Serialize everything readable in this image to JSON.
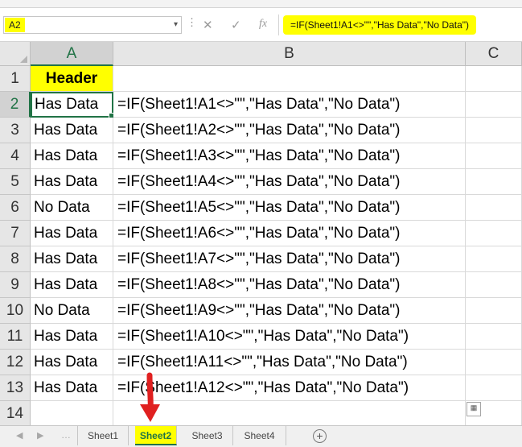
{
  "formula_bar": {
    "name_box": "A2",
    "formula": "=IF(Sheet1!A1<>\"\",\"Has Data\",\"No Data\")",
    "cancel_icon": "x-cancel-icon",
    "enter_icon": "check-enter-icon",
    "fx_label": "fx"
  },
  "grid": {
    "columns": [
      "A",
      "B",
      "C"
    ],
    "rows": [
      {
        "num": "1",
        "a": "Header",
        "b": ""
      },
      {
        "num": "2",
        "a": "Has Data",
        "b": "=IF(Sheet1!A1<>\"\",\"Has Data\",\"No Data\")"
      },
      {
        "num": "3",
        "a": "Has Data",
        "b": "=IF(Sheet1!A2<>\"\",\"Has Data\",\"No Data\")"
      },
      {
        "num": "4",
        "a": "Has Data",
        "b": "=IF(Sheet1!A3<>\"\",\"Has Data\",\"No Data\")"
      },
      {
        "num": "5",
        "a": "Has Data",
        "b": "=IF(Sheet1!A4<>\"\",\"Has Data\",\"No Data\")"
      },
      {
        "num": "6",
        "a": "No Data",
        "b": "=IF(Sheet1!A5<>\"\",\"Has Data\",\"No Data\")"
      },
      {
        "num": "7",
        "a": "Has Data",
        "b": "=IF(Sheet1!A6<>\"\",\"Has Data\",\"No Data\")"
      },
      {
        "num": "8",
        "a": "Has Data",
        "b": "=IF(Sheet1!A7<>\"\",\"Has Data\",\"No Data\")"
      },
      {
        "num": "9",
        "a": "Has Data",
        "b": "=IF(Sheet1!A8<>\"\",\"Has Data\",\"No Data\")"
      },
      {
        "num": "10",
        "a": "No Data",
        "b": "=IF(Sheet1!A9<>\"\",\"Has Data\",\"No Data\")"
      },
      {
        "num": "11",
        "a": "Has Data",
        "b": "=IF(Sheet1!A10<>\"\",\"Has Data\",\"No Data\")"
      },
      {
        "num": "12",
        "a": "Has Data",
        "b": "=IF(Sheet1!A11<>\"\",\"Has Data\",\"No Data\")"
      },
      {
        "num": "13",
        "a": "Has Data",
        "b": "=IF(Sheet1!A12<>\"\",\"Has Data\",\"No Data\")"
      },
      {
        "num": "14",
        "a": "",
        "b": ""
      }
    ]
  },
  "sheet_tabs": [
    "Sheet1",
    "Sheet2",
    "Sheet3",
    "Sheet4"
  ],
  "active_sheet": "Sheet2",
  "colors": {
    "highlight": "#ffff00",
    "excel_green": "#217346",
    "annotation_red": "#e02020"
  }
}
